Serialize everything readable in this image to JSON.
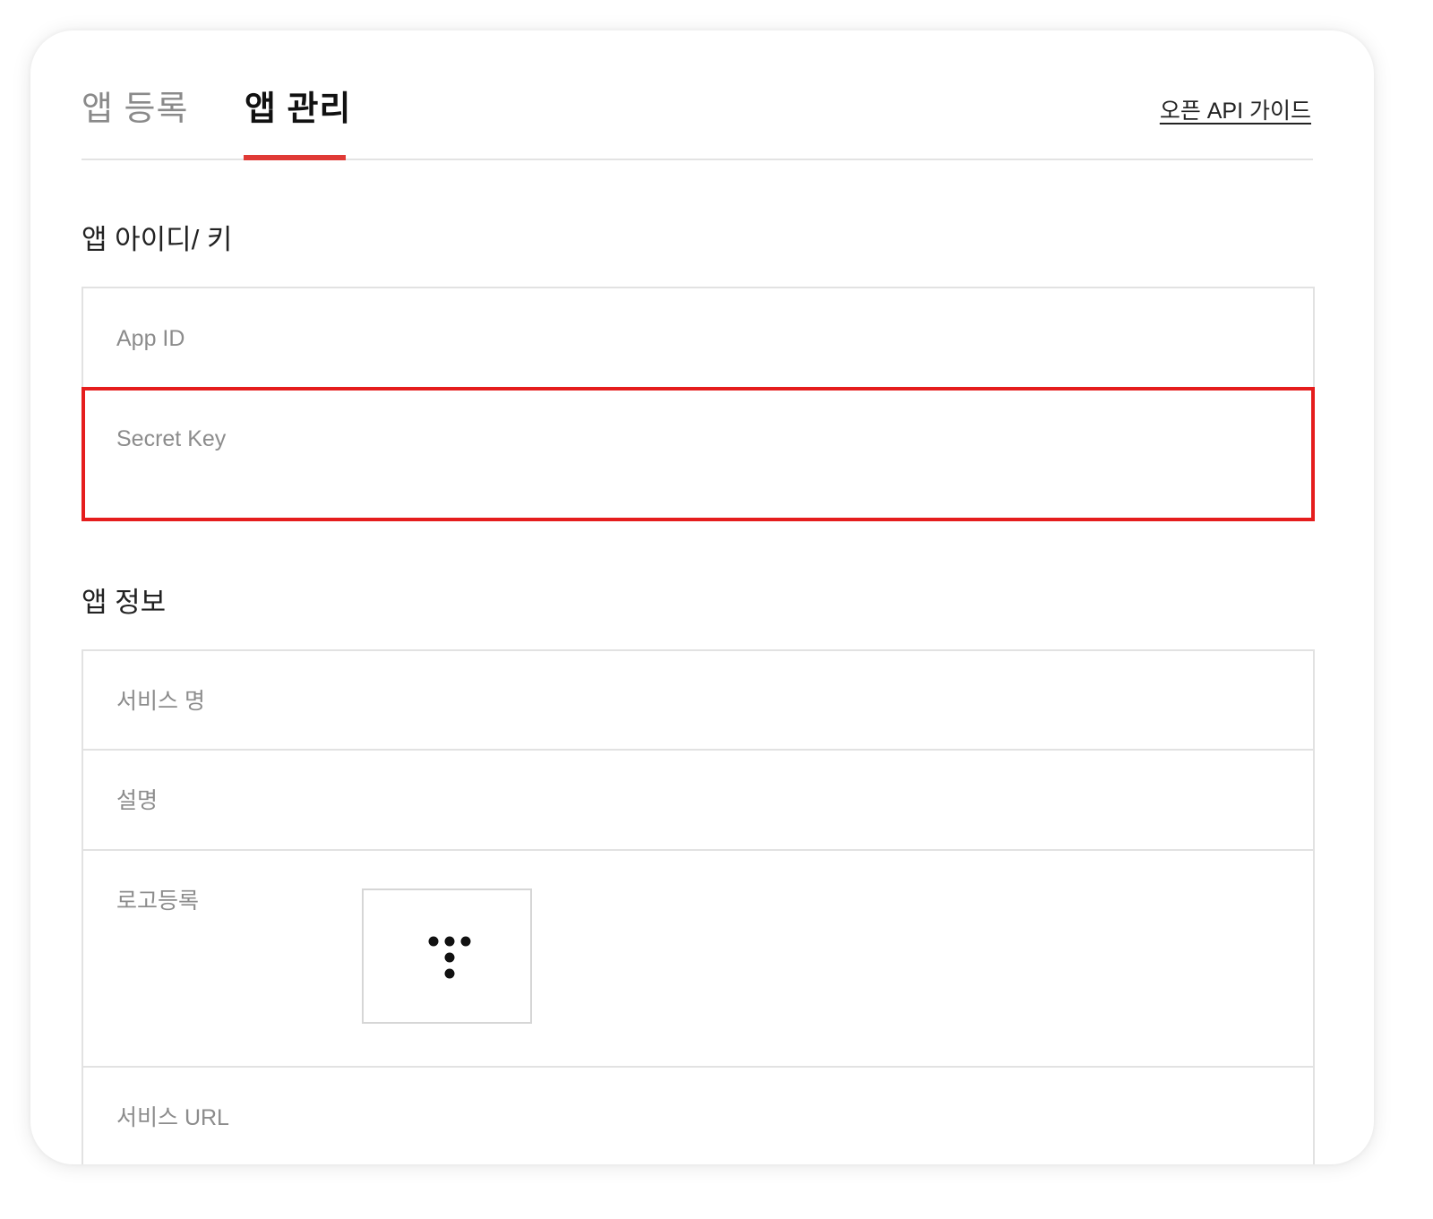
{
  "tabs": {
    "register": "앱 등록",
    "manage": "앱 관리",
    "active": "manage"
  },
  "guide_link": "오픈 API 가이드",
  "sections": {
    "app_id_key": {
      "title": "앱 아이디/ 키",
      "rows": {
        "app_id": {
          "label": "App ID",
          "value": ""
        },
        "secret_key": {
          "label": "Secret Key",
          "value": ""
        }
      }
    },
    "app_info": {
      "title": "앱 정보",
      "rows": {
        "service_name": {
          "label": "서비스 명",
          "value": ""
        },
        "description": {
          "label": "설명",
          "value": ""
        },
        "logo": {
          "label": "로고등록"
        },
        "service_url": {
          "label": "서비스 URL",
          "value": ""
        }
      }
    }
  },
  "colors": {
    "accent": "#e03a36",
    "highlight": "#e51d1d",
    "label": "#8c8c8c",
    "border": "#e2e2e2"
  },
  "icons": {
    "logo": "t-dots-logo"
  }
}
